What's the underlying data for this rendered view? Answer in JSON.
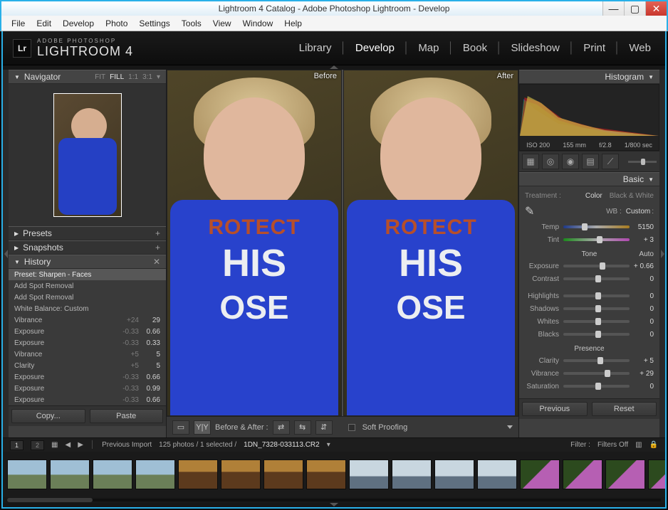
{
  "window": {
    "title": "Lightroom 4 Catalog - Adobe Photoshop Lightroom - Develop"
  },
  "menubar": [
    "File",
    "Edit",
    "Develop",
    "Photo",
    "Settings",
    "Tools",
    "View",
    "Window",
    "Help"
  ],
  "brand": {
    "badge": "Lr",
    "line1": "ADOBE PHOTOSHOP",
    "line2": "LIGHTROOM 4"
  },
  "modules": {
    "items": [
      "Library",
      "Develop",
      "Map",
      "Book",
      "Slideshow",
      "Print",
      "Web"
    ],
    "active": "Develop"
  },
  "left": {
    "navigator": {
      "title": "Navigator",
      "fit": "FIT",
      "fill": "FILL",
      "ratio1": "1:1",
      "ratio2": "3:1"
    },
    "presets": {
      "title": "Presets"
    },
    "snapshots": {
      "title": "Snapshots"
    },
    "history": {
      "title": "History",
      "rows": [
        {
          "label": "Preset: Sharpen - Faces",
          "old": "",
          "new": ""
        },
        {
          "label": "Add Spot Removal",
          "old": "",
          "new": ""
        },
        {
          "label": "Add Spot Removal",
          "old": "",
          "new": ""
        },
        {
          "label": "White Balance: Custom",
          "old": "",
          "new": ""
        },
        {
          "label": "Vibrance",
          "old": "+24",
          "new": "29"
        },
        {
          "label": "Exposure",
          "old": "-0.33",
          "new": "0.66"
        },
        {
          "label": "Exposure",
          "old": "-0.33",
          "new": "0.33"
        },
        {
          "label": "Vibrance",
          "old": "+5",
          "new": "5"
        },
        {
          "label": "Clarity",
          "old": "+5",
          "new": "5"
        },
        {
          "label": "Exposure",
          "old": "-0.33",
          "new": "0.66"
        },
        {
          "label": "Exposure",
          "old": "-0.33",
          "new": "0.99"
        },
        {
          "label": "Exposure",
          "old": "-0.33",
          "new": "0.66"
        }
      ]
    },
    "copy": "Copy...",
    "paste": "Paste"
  },
  "center": {
    "before": "Before",
    "after": "After",
    "toolbar": {
      "before_after_label": "Before & After :",
      "soft_proofing": "Soft Proofing"
    }
  },
  "right": {
    "histogram": {
      "title": "Histogram",
      "iso": "ISO 200",
      "focal": "155 mm",
      "aperture": "f/2.8",
      "shutter": "1/800 sec"
    },
    "basic": {
      "title": "Basic",
      "treatment_label": "Treatment :",
      "treatment_color": "Color",
      "treatment_bw": "Black & White",
      "wb_label": "WB :",
      "wb_value": "Custom",
      "temp_label": "Temp",
      "temp_value": "5150",
      "tint_label": "Tint",
      "tint_value": "+ 3",
      "tone_title": "Tone",
      "auto": "Auto",
      "exposure_label": "Exposure",
      "exposure_value": "+ 0.66",
      "contrast_label": "Contrast",
      "contrast_value": "0",
      "highlights_label": "Highlights",
      "highlights_value": "0",
      "shadows_label": "Shadows",
      "shadows_value": "0",
      "whites_label": "Whites",
      "whites_value": "0",
      "blacks_label": "Blacks",
      "blacks_value": "0",
      "presence_title": "Presence",
      "clarity_label": "Clarity",
      "clarity_value": "+ 5",
      "vibrance_label": "Vibrance",
      "vibrance_value": "+ 29",
      "saturation_label": "Saturation",
      "saturation_value": "0"
    },
    "previous": "Previous",
    "reset": "Reset"
  },
  "filterbar": {
    "source": "Previous Import",
    "count": "125 photos / 1 selected /",
    "filename": "1DN_7328-033113.CR2",
    "filter_label": "Filter :",
    "filter_value": "Filters Off"
  }
}
